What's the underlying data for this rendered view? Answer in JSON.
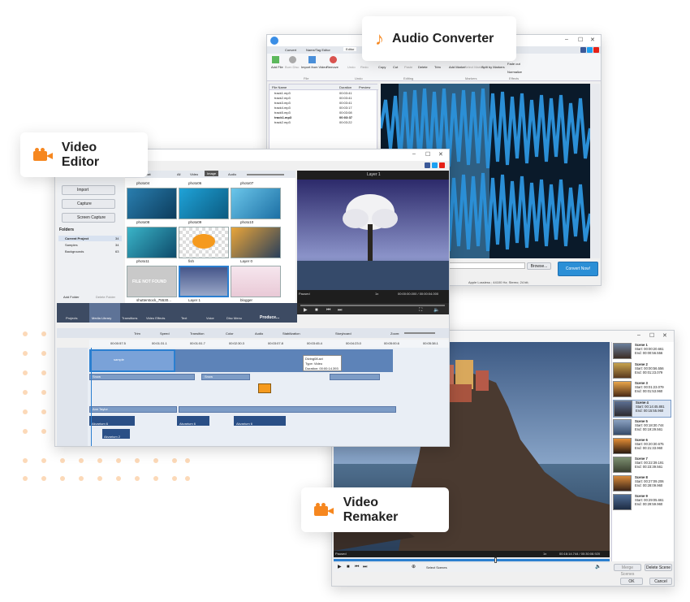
{
  "labels": {
    "audio_converter": "Audio Converter",
    "video_editor": "Video Editor",
    "video_remaker": "Video Remaker"
  },
  "audio": {
    "tabs": [
      "Convert",
      "Name/Tag Editor",
      "Editor"
    ],
    "toolbar": [
      "Add File",
      "Burn Disc",
      "Import from Video",
      "Remove",
      "Undo",
      "Redo",
      "Copy",
      "Cut",
      "Paste",
      "Delete",
      "Trim",
      "Add Marker",
      "Select Marker",
      "Split by Markers",
      "Fade out",
      "Normalize"
    ],
    "groups": [
      "File",
      "Undo",
      "Editing",
      "Markers",
      "Effects"
    ],
    "columns": [
      "File Name",
      "Duration",
      "Preview"
    ],
    "files": [
      {
        "name": "track1.mp3",
        "duration": "00:03:41"
      },
      {
        "name": "track2.mp3",
        "duration": "00:03:41"
      },
      {
        "name": "track3.mp3",
        "duration": "00:03:41"
      },
      {
        "name": "track4.mp3",
        "duration": "00:03:17"
      },
      {
        "name": "track5.mp3",
        "duration": "00:03:08"
      },
      {
        "name": "track1.mp3",
        "duration": "00:03:37"
      },
      {
        "name": "track2.mp3",
        "duration": "00:03:22"
      }
    ],
    "browse": "Browse...",
    "convert": "Convert Now!",
    "status": "Apple Lossless ; 44100 Hz; Stereo; 24 bit;"
  },
  "editor": {
    "tabs": [
      "Project",
      "All",
      "Video",
      "Image",
      "Audio"
    ],
    "side_buttons": [
      "Import",
      "Capture",
      "Screen Capture"
    ],
    "folders_title": "Folders",
    "folders": [
      {
        "name": "Current Project",
        "count": "34"
      },
      {
        "name": "Samples",
        "count": "34"
      },
      {
        "name": "Backgrounds",
        "count": "63"
      }
    ],
    "add_folder": "Add Folder",
    "delete_folder": "Delete Folder",
    "thumbs": [
      "photo04",
      "photo06",
      "photo07",
      "photo08",
      "photo09",
      "photo10",
      "photo11",
      "fish",
      "Layer 0",
      "shutterstock_75530...",
      "Layer 1",
      "blogger"
    ],
    "file_not_found": "FILE NOT FOUND",
    "preview_title": "Layer 1",
    "paused": "Paused",
    "speed": "1x",
    "time": "00:00:00.000 / 00:00:04.000",
    "ribbon": [
      "Projects",
      "Media Library",
      "Transitions",
      "Video Effects",
      "Text",
      "Voice",
      "Disc Menu",
      "Produce..."
    ],
    "tl_tools": [
      "Trim",
      "Speed",
      "Transition",
      "Color",
      "Audio",
      "Stabilization",
      "Storyboard",
      "Zoom:"
    ],
    "ruler": [
      "00:00:57.5",
      "00:01:31.1",
      "00:01:51.7",
      "00:02:30.3",
      "00:03:07.8",
      "00:03:45.4",
      "00:04:23.0",
      "00:05:00.6",
      "00:05:38.1"
    ],
    "tooltip": [
      "Diving08.avi",
      "Type: Video",
      "Duration: 00:00:14.393"
    ],
    "clip_labels": [
      "sample",
      "Snow",
      "Snow",
      "Ann Taylor",
      "Snow"
    ],
    "audio_clips": [
      "Akvarium 6",
      "Akvarium 6",
      "Akvarium 6",
      "Akvarium 2"
    ]
  },
  "remaker": {
    "paused": "Paused",
    "speed": "1x",
    "time": "00:16:14.744 / 00:30:08.920",
    "select_scenes": "Select Scenes",
    "merge": "Merge Scenes",
    "delete": "Delete Scene",
    "ok": "OK",
    "cancel": "Cancel",
    "scenes": [
      {
        "title": "Scene 1",
        "start": "Start: 00:00:20.661",
        "end": "End:   00:00:56.556"
      },
      {
        "title": "Scene 2",
        "start": "Start: 00:00:56.556",
        "end": "End:   00:01:23.079"
      },
      {
        "title": "Scene 3",
        "start": "Start: 00:01:23.079",
        "end": "End:   00:01:53.960"
      },
      {
        "title": "Scene 4",
        "start": "Start: 00:14:45.881",
        "end": "End:   00:15:55.960"
      },
      {
        "title": "Scene 5",
        "start": "Start: 00:18:30.744",
        "end": "End:   00:19:29.561"
      },
      {
        "title": "Scene 6",
        "start": "Start: 00:20:30.675",
        "end": "End:   00:21:33.960"
      },
      {
        "title": "Scene 7",
        "start": "Start: 00:22:39.191",
        "end": "End:   00:23:39.561"
      },
      {
        "title": "Scene 8",
        "start": "Start: 00:27:09.206",
        "end": "End:   00:28:09.960"
      },
      {
        "title": "Scene 9",
        "start": "Start: 00:29:05.661",
        "end": "End:   00:29:59.960"
      }
    ]
  },
  "colors": {
    "accent": "#f6871f",
    "ribbon": "#3d4b63",
    "wave": "#2b8fd6"
  }
}
